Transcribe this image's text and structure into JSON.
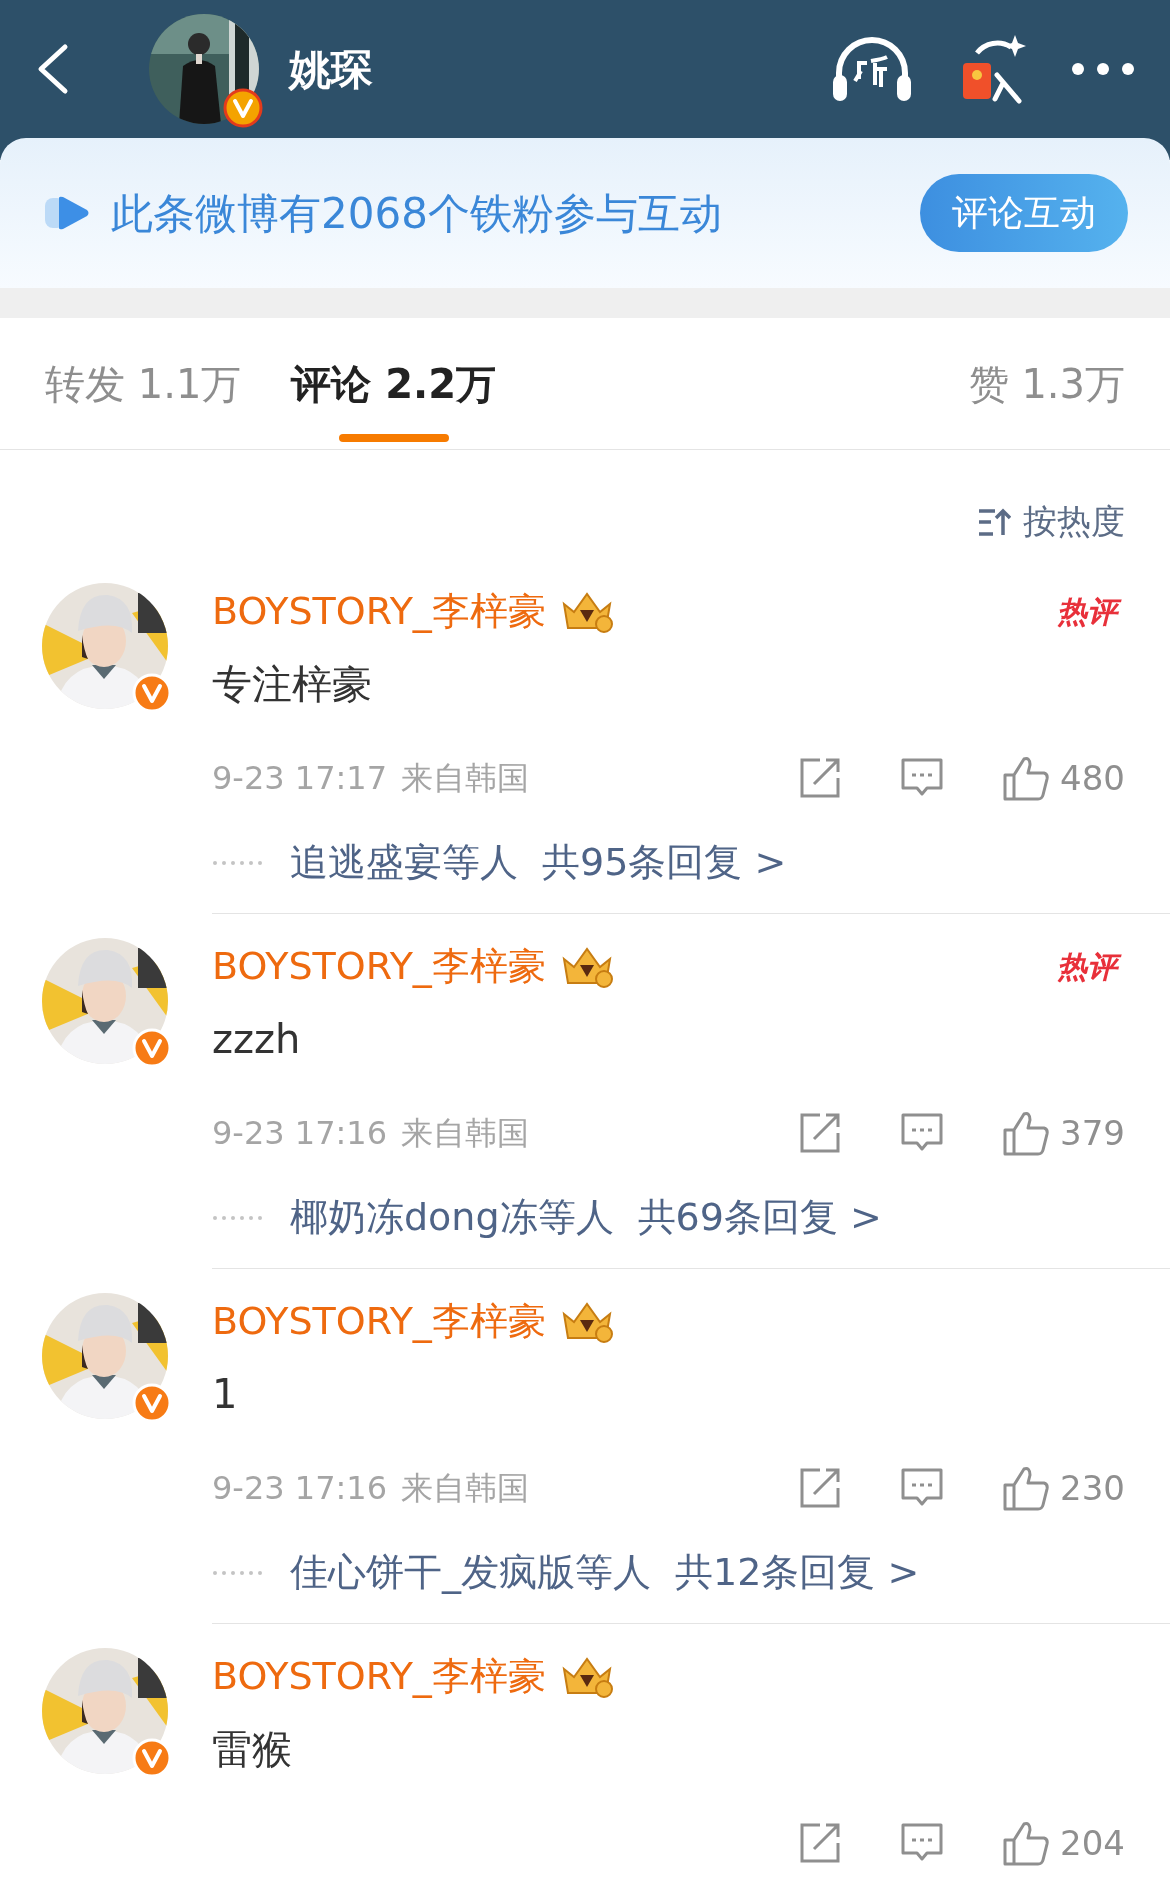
{
  "header": {
    "title": "姚琛",
    "verified": true
  },
  "banner": {
    "text": "此条微博有2068个铁粉参与互动",
    "button": "评论互动"
  },
  "tabs": [
    {
      "label": "转发 1.1万",
      "selected": false
    },
    {
      "label": "评论 2.2万",
      "selected": true
    },
    {
      "label": "赞 1.3万",
      "selected": false
    }
  ],
  "sort": {
    "label": "按热度"
  },
  "comments": [
    {
      "user": "BOYSTORY_李梓豪",
      "verified": true,
      "hot_label": "热评",
      "text": "专注梓豪",
      "time": "9-23 17:17",
      "location": "来自韩国",
      "likes": "480",
      "replies": {
        "names": "追逃盛宴等人",
        "count": "共95条回复 >"
      }
    },
    {
      "user": "BOYSTORY_李梓豪",
      "verified": true,
      "hot_label": "热评",
      "text": "zzzh",
      "time": "9-23 17:16",
      "location": "来自韩国",
      "likes": "379",
      "replies": {
        "names": "椰奶冻dong冻等人",
        "count": "共69条回复 >"
      }
    },
    {
      "user": "BOYSTORY_李梓豪",
      "verified": true,
      "text": "1",
      "time": "9-23 17:16",
      "location": "来自韩国",
      "likes": "230",
      "replies": {
        "names": "佳心饼干_发疯版等人",
        "count": "共12条回复 >"
      }
    },
    {
      "user": "BOYSTORY_李梓豪",
      "verified": true,
      "text": "雷猴",
      "likes": "204"
    }
  ]
}
